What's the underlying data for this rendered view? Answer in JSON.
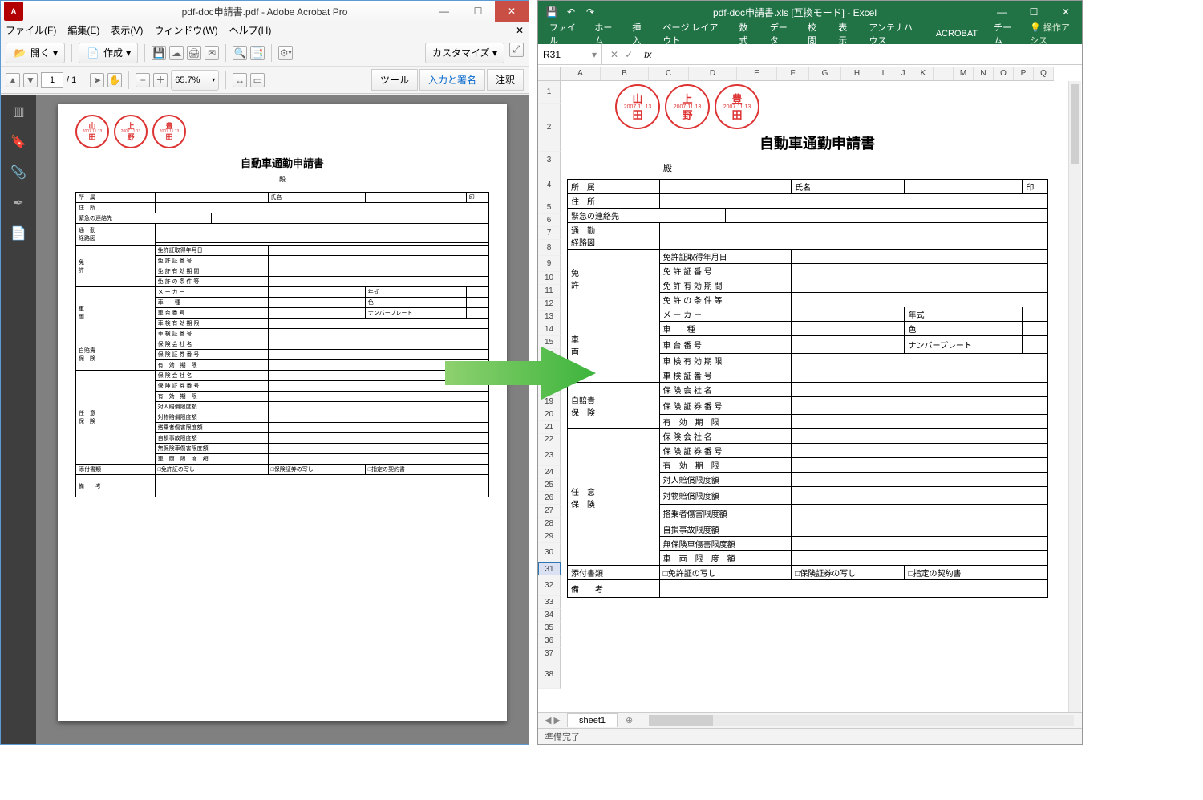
{
  "acrobat": {
    "title": "pdf-doc申請書.pdf - Adobe Acrobat Pro",
    "menu": {
      "file": "ファイル(F)",
      "edit": "編集(E)",
      "view": "表示(V)",
      "window": "ウィンドウ(W)",
      "help": "ヘルプ(H)"
    },
    "toolbar1": {
      "open": "開く",
      "create": "作成",
      "dd": "▾",
      "customize": "カスタマイズ ▾"
    },
    "toolbar2": {
      "page": "1",
      "pages": "/ 1",
      "zoom": "65.7%",
      "tools": "ツール",
      "sign": "入力と署名",
      "comment": "注釈"
    },
    "doc": {
      "stamps": [
        {
          "top": "山",
          "date": "2007.11.13",
          "bottom": "田"
        },
        {
          "top": "上",
          "date": "2007.11.13",
          "bottom": "野"
        },
        {
          "top": "豊",
          "date": "2007.11.13",
          "bottom": "田"
        }
      ],
      "title": "自動車通勤申請書",
      "dono": "殿",
      "rows": {
        "affil": "所　属",
        "name": "氏名",
        "seal": "印",
        "addr": "住　所",
        "emerg": "緊急の連絡先",
        "route": "通　勤\n経路図",
        "license": "免\n許",
        "lic1": "免許証取得年月日",
        "lic2": "免 許 証 番 号",
        "lic3": "免 許 有 効 期 間",
        "lic4": "免 許 の 条 件 等",
        "car": "車\n両",
        "mk": "メ ー カ ー",
        "yr": "年式",
        "type": "車　　種",
        "col": "色",
        "cnum": "車 台 番 号",
        "plate": "ナンバープレート",
        "insp": "車 検 有 効 期 限",
        "inspno": "車 検 証 番 号",
        "jibai": "自賠責\n保　険",
        "co": "保 険 会 社 名",
        "cert": "保 険 証 券 番 号",
        "valid": "有　効　期　限",
        "nini": "任　意\n保　険",
        "co2": "保 険 会 社 名",
        "cert2": "保 険 証 券 番 号",
        "valid2": "有　効　期　限",
        "p1": "対人賠償限度額",
        "p2": "対物賠償限度額",
        "p3": "搭乗者傷害限度額",
        "p4": "自損事故限度額",
        "p5": "無保険車傷害限度額",
        "p6": "車　両　限　度　額",
        "attach": "添付書類",
        "a1": "□免許証の写し",
        "a2": "□保険証券の写し",
        "a3": "□指定の契約書",
        "remarks": "備　　考"
      }
    }
  },
  "excel": {
    "title": "pdf-doc申請書.xls [互換モード] - Excel",
    "qat": {
      "save": "💾",
      "undo": "↶",
      "redo": "↷"
    },
    "ribbon": {
      "file": "ファイル",
      "home": "ホーム",
      "insert": "挿入",
      "layout": "ページ レイアウト",
      "formula": "数式",
      "data": "データ",
      "review": "校閲",
      "view": "表示",
      "antenna": "アンテナハウス",
      "acrobat": "ACROBAT",
      "team": "チーム",
      "tell": "操作アシス"
    },
    "namebox": "R31",
    "fx": "fx",
    "cols": [
      "A",
      "B",
      "C",
      "D",
      "E",
      "F",
      "G",
      "H",
      "I",
      "J",
      "K",
      "L",
      "M",
      "N",
      "O",
      "P",
      "Q"
    ],
    "rowcount": 38,
    "special_row": 31,
    "sheet_tab": "sheet1",
    "status": "準備完了"
  }
}
